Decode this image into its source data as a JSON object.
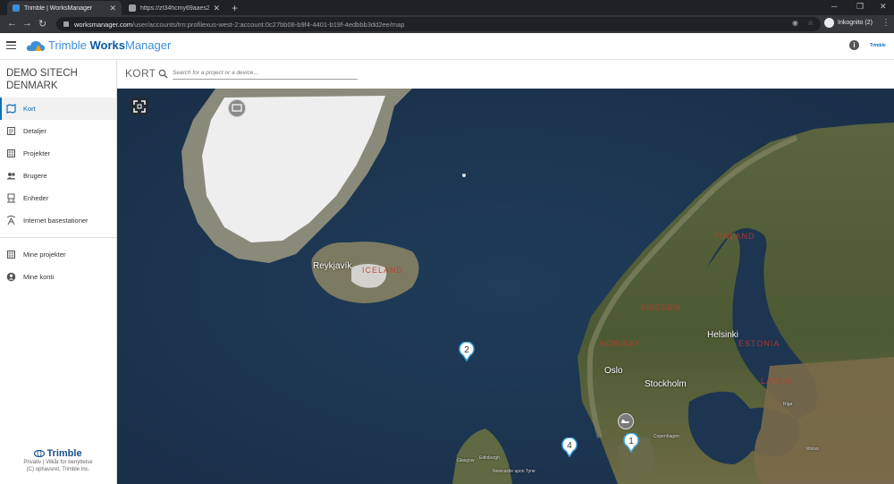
{
  "browser": {
    "tabs": [
      {
        "title": "Trimble | WorksManager",
        "active": true
      },
      {
        "title": "https://zt34hcmy69aaes2.p55.rt...",
        "active": false
      }
    ],
    "url_host": "worksmanager.com",
    "url_path": "/user/accounts/trn:profilexus-west-2:account:0c27bb08-b9f4-4401-b19f-4edbbb3dd2ee/map",
    "incognito_label": "Inkognito (2)"
  },
  "header": {
    "logo_part1": "Trimble",
    "logo_part2": "Works",
    "logo_part3": "Manager",
    "mini_logo": "Trimble"
  },
  "sidebar": {
    "account_name": "DEMO SITECH DENMARK",
    "items": [
      {
        "label": "Kort",
        "icon": "map-icon",
        "active": true
      },
      {
        "label": "Detaljer",
        "icon": "details-icon"
      },
      {
        "label": "Projekter",
        "icon": "projects-icon"
      },
      {
        "label": "Brugere",
        "icon": "users-icon"
      },
      {
        "label": "Enheder",
        "icon": "devices-icon"
      },
      {
        "label": "Internet basestationer",
        "icon": "basestation-icon"
      }
    ],
    "items2": [
      {
        "label": "Mine projekter",
        "icon": "my-projects-icon"
      },
      {
        "label": "Mine konti",
        "icon": "account-icon"
      }
    ],
    "footer_logo": "Trimble",
    "footer_line1": "Privativ | Vilkår for benyttelse",
    "footer_line2": "(C) ophavsret, Trimble Inc."
  },
  "page": {
    "title": "KORT",
    "search_placeholder": "Search for a project or a device..."
  },
  "map": {
    "labels": {
      "reykjavik": "Reykjavík",
      "iceland": "ICELAND",
      "norway": "NORWAY",
      "sweden": "SWEDEN",
      "finland": "FINLAND",
      "estonia": "ESTONIA",
      "latvia": "LATVIA",
      "oslo": "Oslo",
      "stockholm": "Stockholm",
      "helsinki": "Helsinki",
      "edinburgh": "Edinburgh",
      "glasgow": "Glasgow",
      "newcastle": "Newcastle upon Tyne",
      "copenhagen": "Copenhagen",
      "vilnius": "Vilnius",
      "riga": "Riga"
    },
    "clusters": [
      {
        "count": "2"
      },
      {
        "count": "4"
      },
      {
        "count": "1"
      }
    ]
  },
  "colors": {
    "accent": "#0e6fb8",
    "sea": "#1e3653",
    "land": "#4f5a35",
    "ice": "#eeeeee"
  }
}
